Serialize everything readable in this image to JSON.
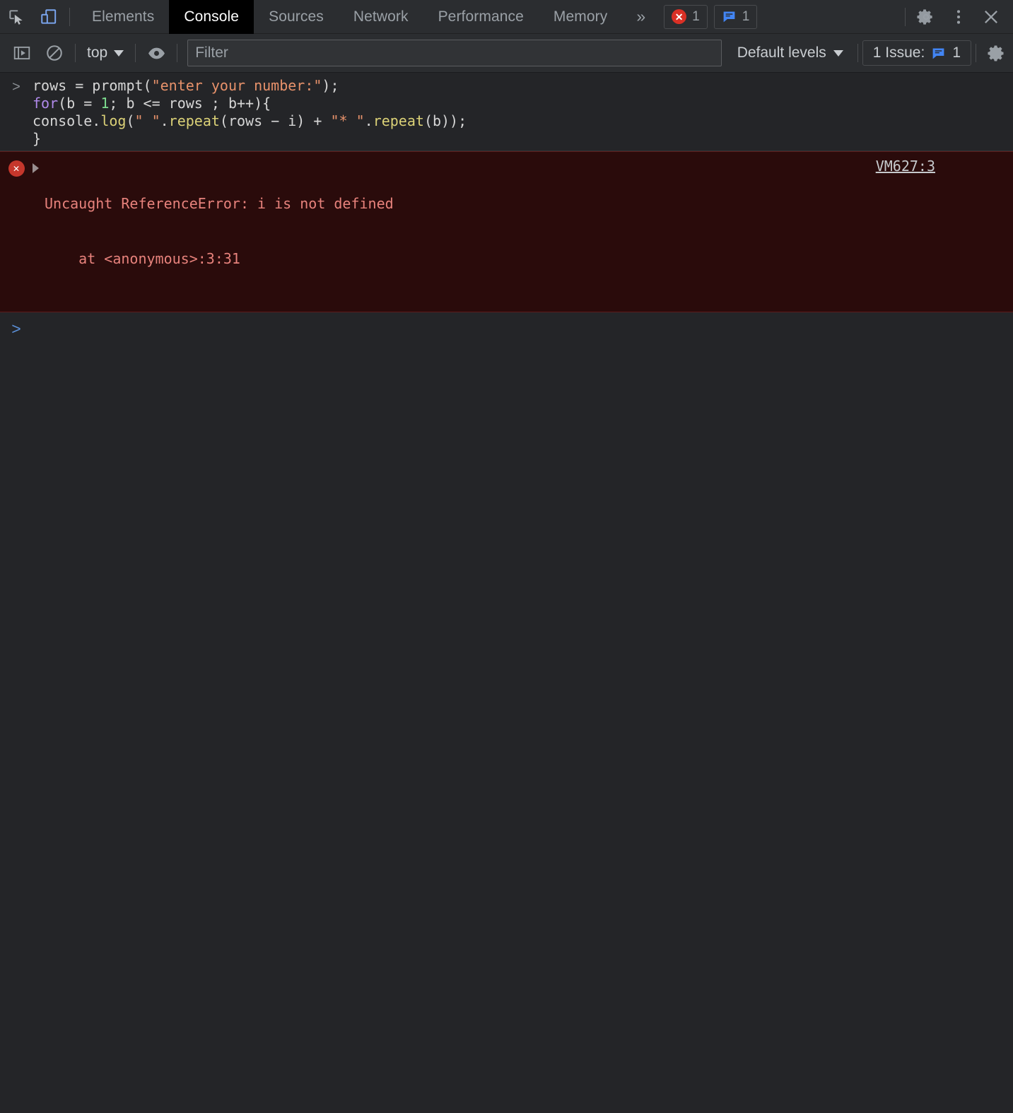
{
  "tabbar": {
    "inspect_icon": "inspect-element-icon",
    "device_icon": "device-toolbar-icon",
    "tabs": [
      {
        "label": "Elements",
        "active": false
      },
      {
        "label": "Console",
        "active": true
      },
      {
        "label": "Sources",
        "active": false
      },
      {
        "label": "Network",
        "active": false
      },
      {
        "label": "Performance",
        "active": false
      },
      {
        "label": "Memory",
        "active": false
      }
    ],
    "overflow_label": "»",
    "error_badge": {
      "icon": "error-circle-icon",
      "count": "1"
    },
    "issue_badge": {
      "icon": "issue-message-icon",
      "count": "1"
    },
    "settings_icon": "gear-icon",
    "more_icon": "kebab-menu-icon",
    "close_icon": "close-icon"
  },
  "filterbar": {
    "sidebar_toggle_icon": "console-sidebar-icon",
    "clear_icon": "clear-console-icon",
    "context_label": "top",
    "eye_icon": "live-expression-eye-icon",
    "filter_placeholder": "Filter",
    "filter_value": "",
    "levels_label": "Default levels",
    "issues_label": "1 Issue:",
    "issues_count": "1",
    "settings_icon": "console-settings-gear-icon"
  },
  "console": {
    "prompt_arrow": ">",
    "command_lines": [
      [
        {
          "t": "rows = ",
          "c": "plain"
        },
        {
          "t": "prompt",
          "c": "plain"
        },
        {
          "t": "(",
          "c": "plain"
        },
        {
          "t": "\"enter your number:\"",
          "c": "str"
        },
        {
          "t": ");",
          "c": "plain"
        }
      ],
      [
        {
          "t": "for",
          "c": "kw"
        },
        {
          "t": "(b = ",
          "c": "plain"
        },
        {
          "t": "1",
          "c": "num"
        },
        {
          "t": "; b <= rows ; b++){",
          "c": "plain"
        }
      ],
      [
        {
          "t": "console.",
          "c": "plain"
        },
        {
          "t": "log",
          "c": "fn"
        },
        {
          "t": "(",
          "c": "plain"
        },
        {
          "t": "\" \"",
          "c": "str"
        },
        {
          "t": ".",
          "c": "plain"
        },
        {
          "t": "repeat",
          "c": "fn"
        },
        {
          "t": "(rows − i) + ",
          "c": "plain"
        },
        {
          "t": "\"* \"",
          "c": "str"
        },
        {
          "t": ".",
          "c": "plain"
        },
        {
          "t": "repeat",
          "c": "fn"
        },
        {
          "t": "(b));",
          "c": "plain"
        }
      ],
      [
        {
          "t": "}",
          "c": "plain"
        }
      ]
    ],
    "error": {
      "icon": "error-circle-icon",
      "message": "Uncaught ReferenceError: i is not defined",
      "stack": "    at <anonymous>:3:31",
      "source_link": "VM627:3"
    },
    "input_caret": ">"
  },
  "colors": {
    "accent_blue": "#5b8fd6",
    "error_red": "#d93025",
    "error_bg": "#2a0b0b",
    "toolbar_bg": "#2b2d30",
    "console_bg": "#242528"
  }
}
